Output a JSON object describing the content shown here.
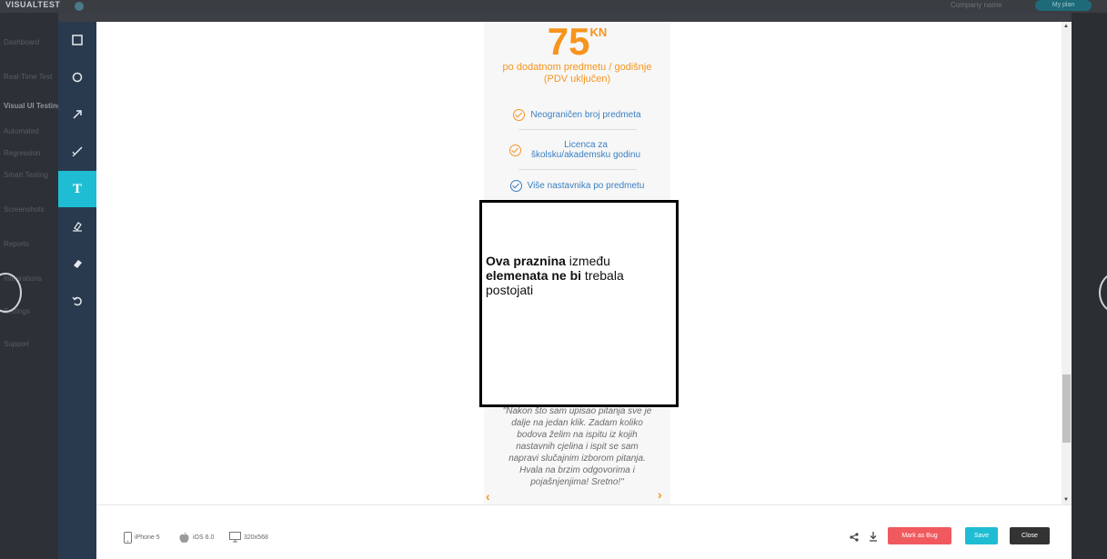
{
  "background": {
    "logo": "VISUALTEST",
    "company_label": "Company name",
    "top_pill": "My plan",
    "sidebar_menu": [
      "Dashboard",
      "Real-Time Test",
      "Visual UI Testing",
      "Automated",
      "Regression",
      "Smart Testing",
      "Screenshots",
      "Reports",
      "Integrations",
      "Settings",
      "Support"
    ]
  },
  "toolbar": {
    "tools": [
      {
        "name": "rectangle",
        "icon": "rectangle-icon",
        "active": false
      },
      {
        "name": "circle",
        "icon": "circle-icon",
        "active": false
      },
      {
        "name": "arrow",
        "icon": "arrow-icon",
        "active": false
      },
      {
        "name": "pen",
        "icon": "pen-icon",
        "active": false
      },
      {
        "name": "text",
        "icon": "text-icon",
        "label": "T",
        "active": true
      },
      {
        "name": "highlighter",
        "icon": "highlighter-icon",
        "active": false
      },
      {
        "name": "eraser",
        "icon": "eraser-icon",
        "active": false
      },
      {
        "name": "undo",
        "icon": "undo-icon",
        "active": false
      }
    ]
  },
  "screenshot": {
    "price": "75",
    "price_unit": "KN",
    "price_desc_line1": "po dodatnom predmetu / godišnje",
    "price_desc_line2": "(PDV uključen)",
    "features": [
      "Neograničen broj predmeta",
      "Licenca za školsku/akademsku godinu",
      "Više nastavnika po predmetu"
    ],
    "testimonial": "\"Nakon što sam upisao pitanja sve je dalje na jedan klik. Zadam koliko bodova želim na ispitu iz kojih nastavnih cjelina i ispit se sam napravi slučajnim izborom pitanja. Hvala na brzim odgovorima i pojašnjenjima! Sretno!\"",
    "prev_arrow": "‹",
    "next_arrow": "›"
  },
  "annotation": {
    "part1_bold": "Ova praznina",
    "part2": " između ",
    "part3_bold": "elemenata ne bi",
    "part4": " trebala postojati"
  },
  "footer": {
    "device": "iPhone 5",
    "os": "iOS 6.0",
    "resolution": "320x568",
    "mark_as_bug": "Mark as Bug",
    "save": "Save",
    "close": "Close"
  },
  "colors": {
    "accent": "#1fbdd3",
    "bug": "#f05a5e",
    "price_orange": "#f7941d",
    "feature_blue": "#3a7fc2",
    "toolbar_bg": "#2a3a4e"
  }
}
